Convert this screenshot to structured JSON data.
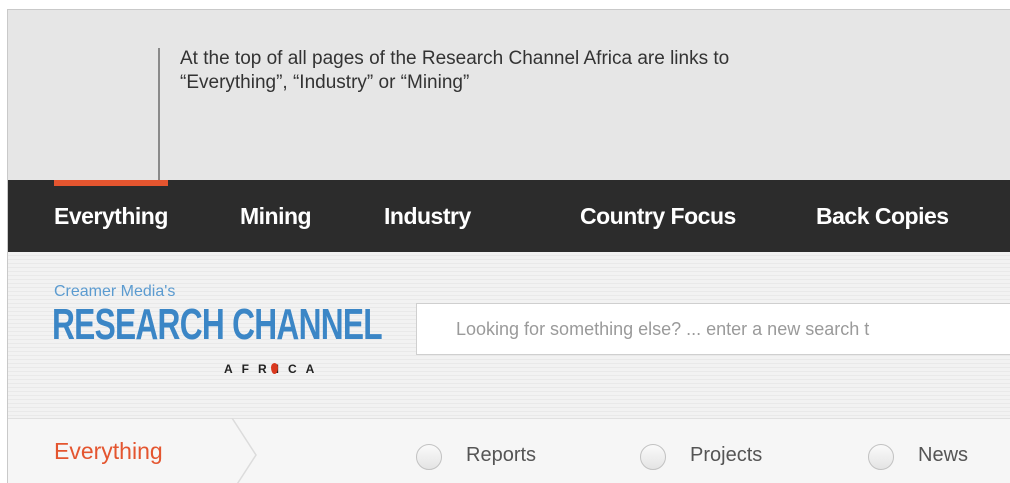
{
  "annotation": {
    "line1": "At the top of all pages of the Research Channel Africa are links to",
    "line2": "“Everything”, “Industry” or “Mining”"
  },
  "nav": {
    "items": [
      {
        "label": "Everything",
        "active": true
      },
      {
        "label": "Mining"
      },
      {
        "label": "Industry"
      },
      {
        "label": "Country Focus"
      },
      {
        "label": "Back Copies"
      }
    ]
  },
  "logo": {
    "top": "Creamer Media's",
    "main": "RESEARCH CHANNEL",
    "sub": "AFRICA"
  },
  "search": {
    "placeholder": "Looking for something else? ... enter a new search t"
  },
  "filter": {
    "active_tab": "Everything",
    "options": [
      {
        "label": "Reports",
        "checked": false
      },
      {
        "label": "Projects",
        "checked": false
      },
      {
        "label": "News",
        "checked": false
      }
    ]
  },
  "colors": {
    "accent": "#e4552f",
    "nav_bg": "#2c2c2c",
    "logo_blue": "#3b86c6"
  }
}
